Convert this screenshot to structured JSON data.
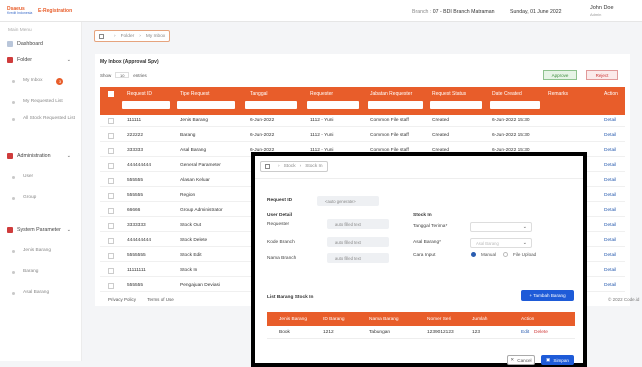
{
  "header": {
    "logo_text": "Dsaeus",
    "logo_sub": "Kredit Indonesia",
    "app_title": "E-Registration",
    "branch_label": "Branch :",
    "branch_value": "07 - BDI Branch Matraman",
    "date": "Sunday, 01 June 2022",
    "user_name": "John Doe",
    "user_role": "Admin"
  },
  "sidebar": {
    "main_menu": "Main Menu",
    "dashboard": "Dashboard",
    "folder": "Folder",
    "folder_items": [
      "My Inbox",
      "My Requested List",
      "All Stock Requested List"
    ],
    "inbox_badge": "3",
    "administration": "Administration",
    "admin_items": [
      "User",
      "Group"
    ],
    "system_parameter": "System Parameter",
    "system_items": [
      "Jenis Barang",
      "Barang",
      "Asal Barang"
    ]
  },
  "breadcrumb": {
    "items": [
      "Folder",
      "My Inbox"
    ]
  },
  "panel": {
    "title": "My Inbox (Approval Spv)",
    "show_label": "Show",
    "show_value": "10",
    "entries_label": "entries",
    "approve_label": "Approve",
    "reject_label": "Reject",
    "columns": [
      "Request ID",
      "Tipe Request",
      "Tanggal",
      "Requester",
      "Jabatan Requester",
      "Request Status",
      "Date Created",
      "Remarks",
      "Action"
    ],
    "rows": [
      {
        "id": "111111",
        "tipe": "Jenis Barang",
        "tanggal": "6-Jun-2022",
        "requester": "1112 - Yuni",
        "jabatan": "Common File staff",
        "status": "Created",
        "date": "6-Jun-2022 15:30",
        "action": "Detail"
      },
      {
        "id": "222222",
        "tipe": "Barang",
        "tanggal": "6-Jun-2022",
        "requester": "1112 - Yuni",
        "jabatan": "Common File staff",
        "status": "Created",
        "date": "6-Jun-2022 15:30",
        "action": "Detail"
      },
      {
        "id": "333333",
        "tipe": "Asal Barang",
        "tanggal": "6-Jun-2022",
        "requester": "1112 - Yuni",
        "jabatan": "Common File staff",
        "status": "Created",
        "date": "6-Jun-2022 15:30",
        "action": "Detail"
      },
      {
        "id": "444444444",
        "tipe": "General Parameter",
        "tanggal": "",
        "requester": "",
        "jabatan": "",
        "status": "",
        "date": "",
        "action": "Detail"
      },
      {
        "id": "555555",
        "tipe": "Alasan Keluar",
        "tanggal": "",
        "requester": "",
        "jabatan": "",
        "status": "",
        "date": "",
        "action": "Detail"
      },
      {
        "id": "555555",
        "tipe": "Region",
        "tanggal": "",
        "requester": "",
        "jabatan": "",
        "status": "",
        "date": "",
        "action": "Detail"
      },
      {
        "id": "66666",
        "tipe": "Group Administrator",
        "tanggal": "",
        "requester": "",
        "jabatan": "",
        "status": "",
        "date": "",
        "action": "Detail"
      },
      {
        "id": "3333333",
        "tipe": "Stock Out",
        "tanggal": "",
        "requester": "",
        "jabatan": "",
        "status": "",
        "date": "",
        "action": "Detail"
      },
      {
        "id": "444444444",
        "tipe": "Stock Delete",
        "tanggal": "",
        "requester": "",
        "jabatan": "",
        "status": "",
        "date": "",
        "action": "Detail"
      },
      {
        "id": "5555555",
        "tipe": "Stock Edit",
        "tanggal": "",
        "requester": "",
        "jabatan": "",
        "status": "",
        "date": "",
        "action": "Detail"
      },
      {
        "id": "11111111",
        "tipe": "Stock In",
        "tanggal": "",
        "requester": "",
        "jabatan": "",
        "status": "",
        "date": "",
        "action": "Detail"
      },
      {
        "id": "555555",
        "tipe": "Pengajuan Deviasi",
        "tanggal": "",
        "requester": "",
        "jabatan": "",
        "status": "",
        "date": "",
        "action": "Detail"
      }
    ]
  },
  "footer": {
    "privacy": "Privacy Policy",
    "terms": "Terms of Use",
    "copyright": "© 2022 Code.id"
  },
  "modal": {
    "breadcrumb": [
      "Stock",
      "Stock In"
    ],
    "request_id_label": "Request ID",
    "request_id_value": "<auto generate>",
    "user_detail": "User Detail",
    "requester_label": "Requester",
    "requester_value": "auto filled text",
    "kode_branch_label": "Kode Branch",
    "kode_branch_value": "auto filled text",
    "nama_branch_label": "Nama Branch",
    "nama_branch_value": "auto filled text",
    "stock_in": "Stock In",
    "tanggal_terima_label": "Tanggal Terima*",
    "tanggal_terima_value": "",
    "asal_barang_label": "Asal Barang*",
    "asal_barang_value": "Asal Barang",
    "cara_input_label": "Cara Input",
    "radio_manual": "Manual",
    "radio_upload": "File Upload",
    "list_title": "List Barang Stock In",
    "add_button": "+ Tambah Barang",
    "columns": [
      "Jenis Barang",
      "ID Barang",
      "Nama Barang",
      "Nomer Seri",
      "Jumlah",
      "Action"
    ],
    "row": {
      "jenis": "Book",
      "id": "1212",
      "nama": "Tabungan",
      "seri": "1239012123",
      "jumlah": "123",
      "edit": "Edit",
      "delete": "Delete"
    },
    "cancel": "Cancel",
    "save": "Simpan"
  }
}
